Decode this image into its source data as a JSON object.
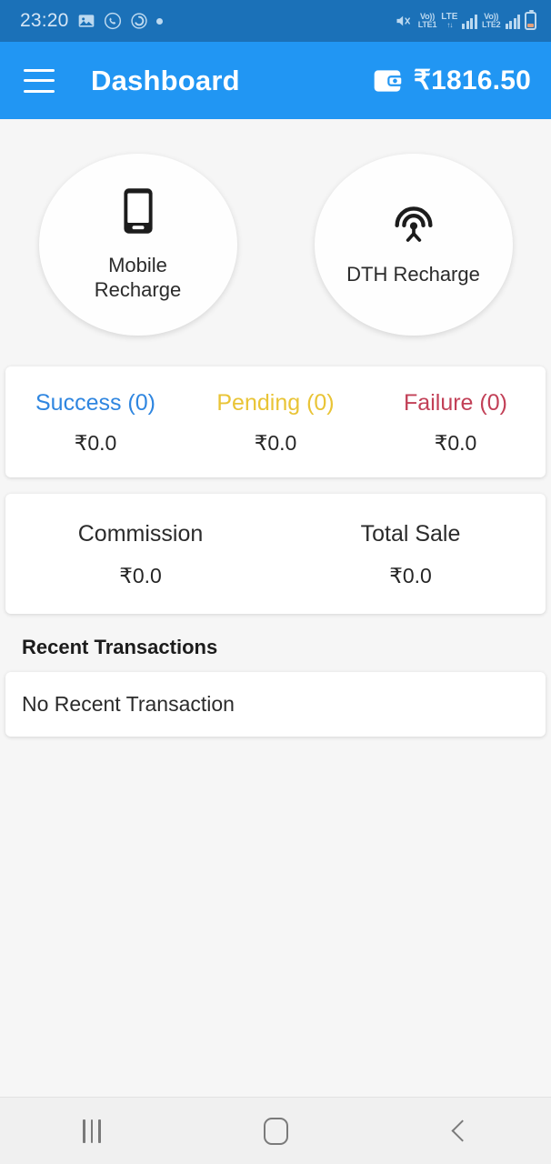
{
  "status_bar": {
    "time": "23:20",
    "left_icons": [
      "gallery-icon",
      "whatsapp-icon",
      "clock-app-icon",
      "dot-indicator"
    ],
    "right_icons": [
      "mute-icon",
      "volte1-icon",
      "lte-icon",
      "signal-bars-1",
      "volte2-icon",
      "signal-bars-2",
      "battery-icon"
    ],
    "volte1_top": "Vo))",
    "volte1_bottom": "LTE1",
    "lte_label": "LTE",
    "lte_arrows": "↑↓",
    "volte2_top": "Vo))",
    "volte2_bottom": "LTE2",
    "background": "#1B71B8"
  },
  "app_bar": {
    "menu_icon": "hamburger-menu-icon",
    "title": "Dashboard",
    "wallet_icon": "wallet-icon",
    "wallet_balance": "₹1816.50",
    "background": "#2196F3"
  },
  "quick_actions": [
    {
      "icon": "smartphone-icon",
      "label": "Mobile\nRecharge",
      "line1": "Mobile",
      "line2": "Recharge"
    },
    {
      "icon": "broadcast-tower-icon",
      "label": "DTH Recharge",
      "line1": "DTH Recharge",
      "line2": ""
    }
  ],
  "stats": {
    "items": [
      {
        "label": "Success (0)",
        "value": "₹0.0",
        "color": "#2F86E0",
        "count": 0
      },
      {
        "label": "Pending (0)",
        "value": "₹0.0",
        "color": "#E9C436",
        "count": 0
      },
      {
        "label": "Failure (0)",
        "value": "₹0.0",
        "color": "#C24057",
        "count": 0
      }
    ]
  },
  "totals": {
    "items": [
      {
        "label": "Commission",
        "value": "₹0.0"
      },
      {
        "label": "Total Sale",
        "value": "₹0.0"
      }
    ]
  },
  "recent_transactions": {
    "title": "Recent Transactions",
    "empty_message": "No Recent Transaction"
  },
  "nav_bar": {
    "buttons": [
      {
        "name": "recents-button",
        "icon": "recents-icon"
      },
      {
        "name": "home-button",
        "icon": "home-icon"
      },
      {
        "name": "back-button",
        "icon": "back-icon"
      }
    ],
    "background": "#F0F0F0"
  },
  "theme": {
    "page_background": "#F6F6F6",
    "card_background": "#FFFFFF",
    "accent": "#2196F3"
  }
}
